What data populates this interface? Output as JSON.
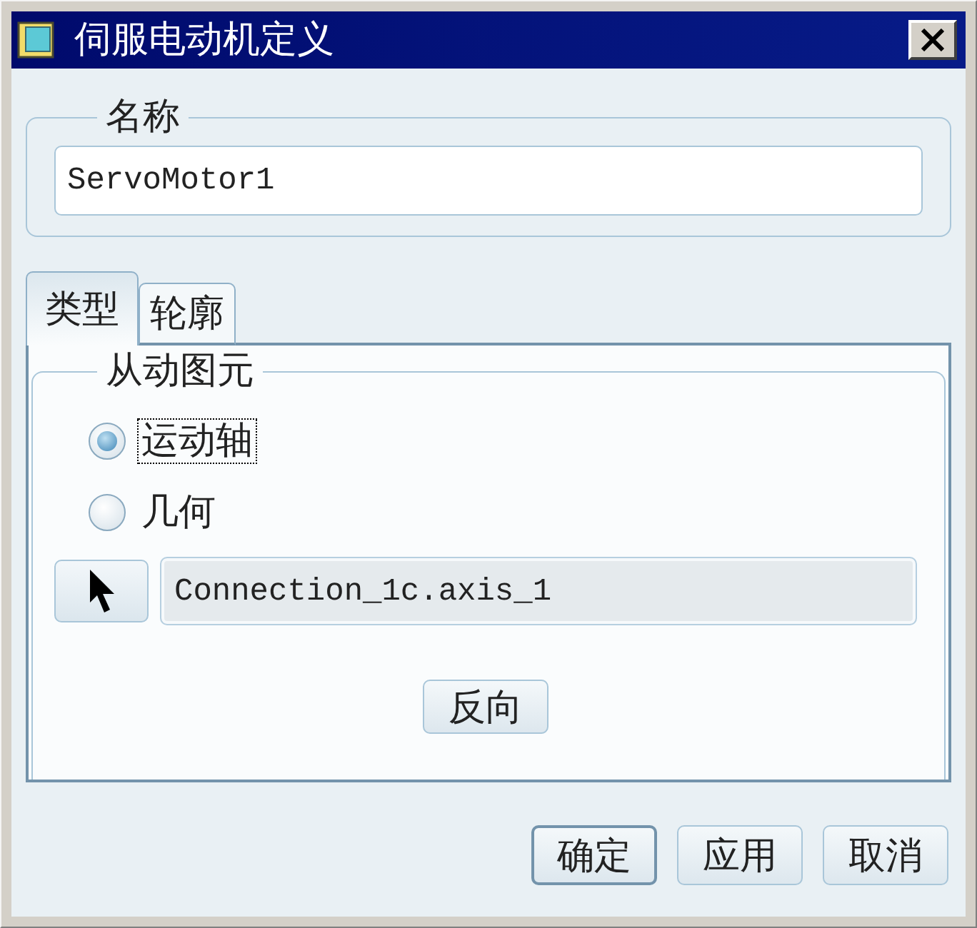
{
  "window": {
    "title": "伺服电动机定义"
  },
  "name_group": {
    "legend": "名称",
    "value": "ServoMotor1"
  },
  "tabs": [
    {
      "label": "类型",
      "selected": true
    },
    {
      "label": "轮廓",
      "selected": false
    }
  ],
  "driven_entity": {
    "legend": "从动图元",
    "options": [
      {
        "label": "运动轴",
        "selected": true,
        "focused": true
      },
      {
        "label": "几何",
        "selected": false,
        "focused": false
      }
    ],
    "selection": {
      "value": "Connection_1c.axis_1"
    },
    "flip_button": "反向"
  },
  "buttons": [
    {
      "label": "确定",
      "default": true
    },
    {
      "label": "应用",
      "default": false
    },
    {
      "label": "取消",
      "default": false
    }
  ]
}
